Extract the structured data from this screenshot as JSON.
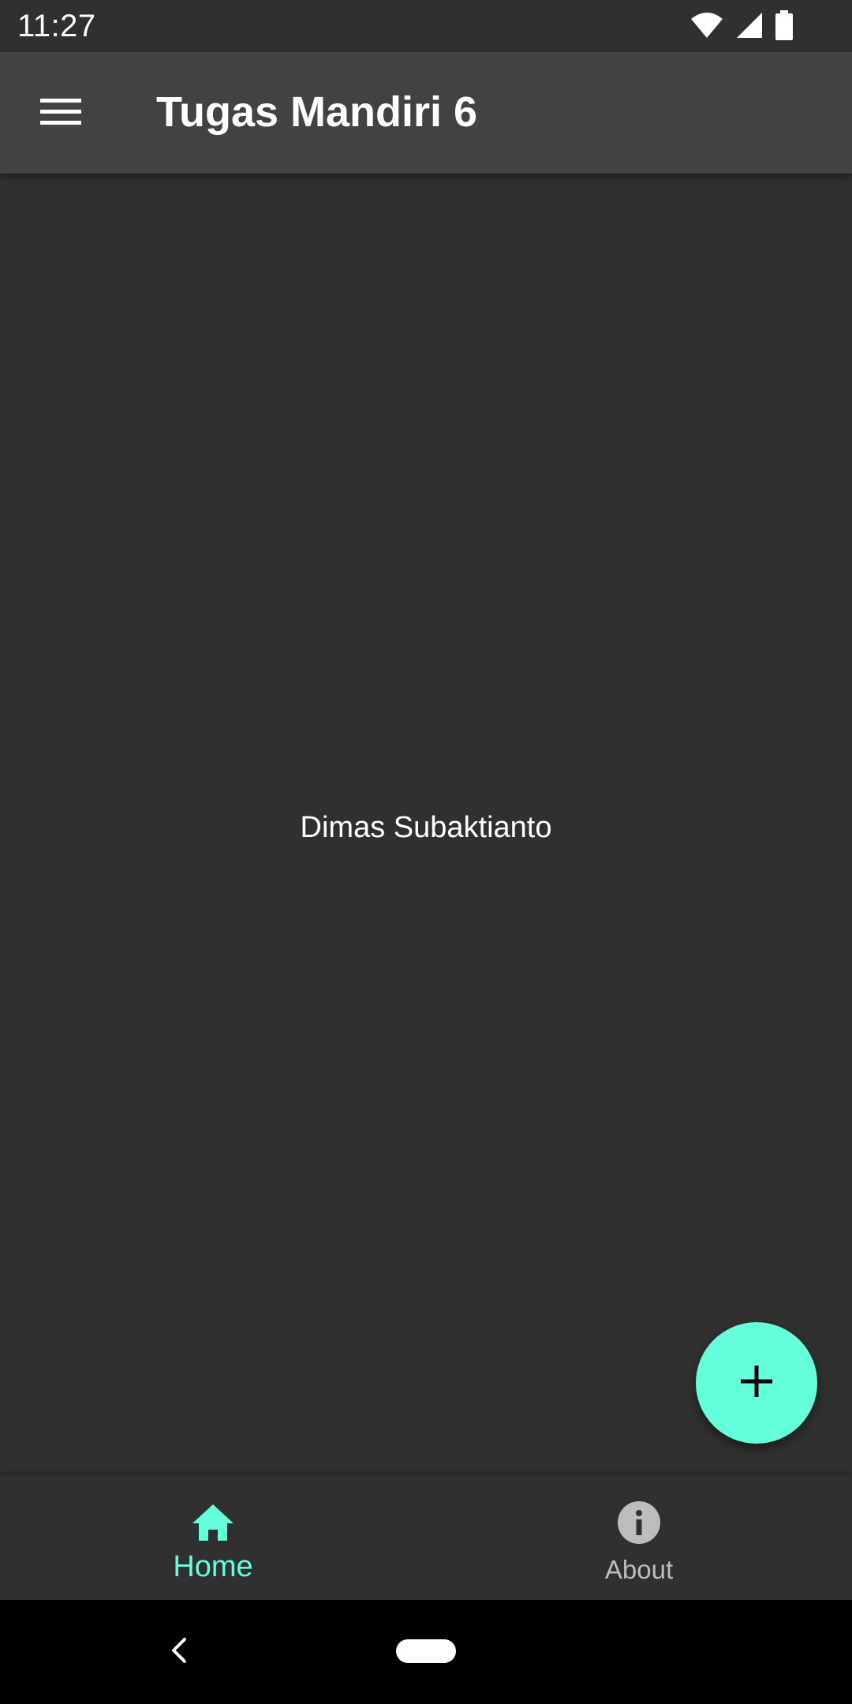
{
  "status_bar": {
    "time": "11:27",
    "icons": [
      "wifi-icon",
      "signal-icon",
      "battery-icon"
    ]
  },
  "app_bar": {
    "menu_icon": "hamburger-menu-icon",
    "title": "Tugas Mandiri 6"
  },
  "main": {
    "center_text": "Dimas Subaktianto"
  },
  "fab": {
    "icon": "plus-icon"
  },
  "bottom_nav": {
    "items": [
      {
        "label": "Home",
        "icon": "home-icon",
        "active": true
      },
      {
        "label": "About",
        "icon": "info-icon",
        "active": false
      }
    ]
  },
  "system_nav": {
    "icons": [
      "back-icon",
      "home-pill"
    ]
  },
  "colors": {
    "background": "#303030",
    "app_bar": "#424242",
    "accent": "#64ffda",
    "text_primary": "#ffffff",
    "text_inactive": "#bdbdbd",
    "system_nav": "#000000"
  }
}
